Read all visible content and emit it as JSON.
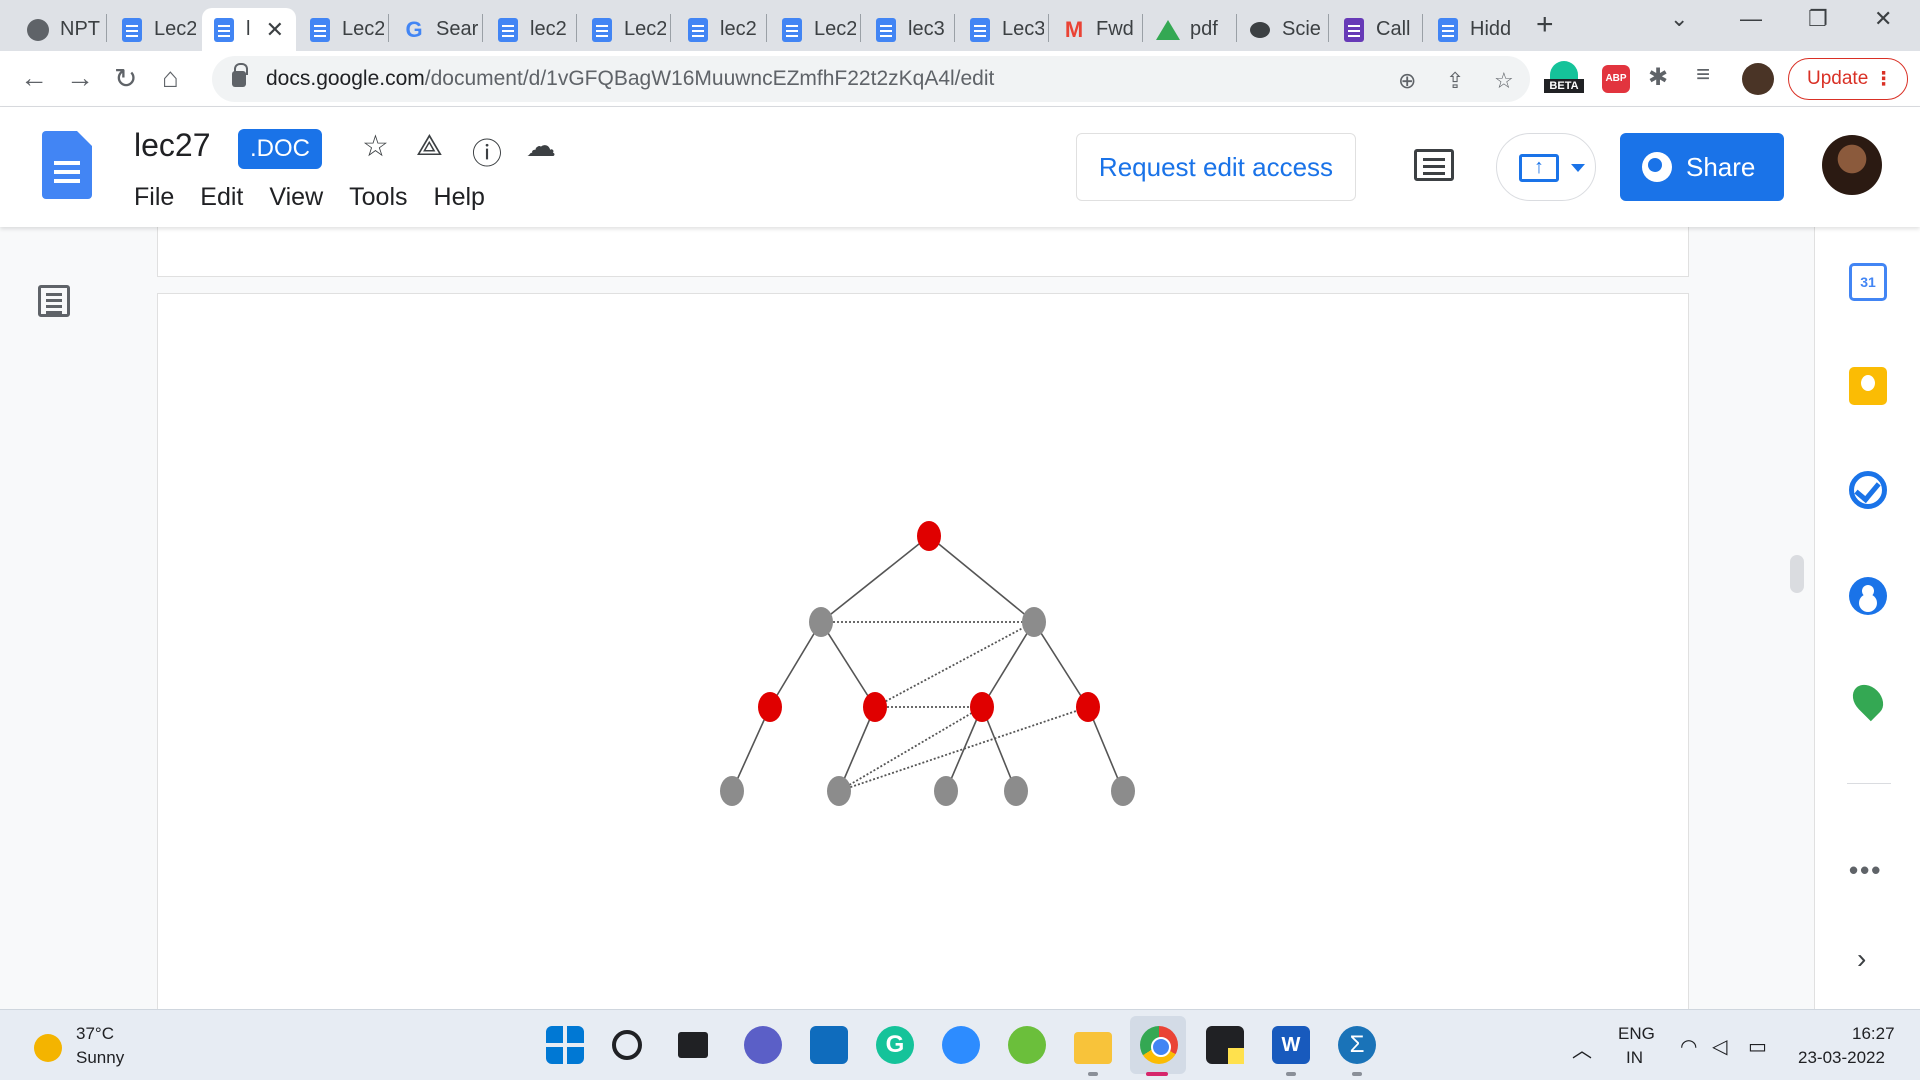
{
  "browser": {
    "tabs": [
      {
        "label": "NPT",
        "icon": "globe-icon"
      },
      {
        "label": "Lec2",
        "icon": "docs-icon"
      },
      {
        "label": "l",
        "icon": "docs-icon",
        "active": true
      },
      {
        "label": "Lec2",
        "icon": "docs-icon"
      },
      {
        "label": "Sear",
        "icon": "google-icon"
      },
      {
        "label": "lec2",
        "icon": "docs-icon"
      },
      {
        "label": "Lec2",
        "icon": "docs-icon"
      },
      {
        "label": "lec2",
        "icon": "docs-icon"
      },
      {
        "label": "Lec2",
        "icon": "docs-icon"
      },
      {
        "label": "lec3",
        "icon": "docs-icon"
      },
      {
        "label": "Lec3",
        "icon": "docs-icon"
      },
      {
        "label": "Fwd",
        "icon": "gmail-icon"
      },
      {
        "label": "pdf",
        "icon": "drive-icon"
      },
      {
        "label": "Scie",
        "icon": "chat-icon"
      },
      {
        "label": "Call",
        "icon": "forms-icon"
      },
      {
        "label": "Hidd",
        "icon": "docs-icon"
      }
    ],
    "new_tab_symbol": "+",
    "url_host": "docs.google.com",
    "url_path": "/document/d/1vGFQBagW16MuuwncEZmfhF22t2zKqA4l/edit",
    "beta_label": "BETA",
    "abp_label": "ABP",
    "update_label": "Update"
  },
  "docs": {
    "title": "lec27",
    "badge": ".DOC",
    "menu": [
      "File",
      "Edit",
      "View",
      "Tools",
      "Help"
    ],
    "request_edit_label": "Request edit access",
    "share_label": "Share"
  },
  "figure": {
    "colors": {
      "highlighted": "#e00000",
      "default": "#8c8c8c",
      "edge": "#555555"
    },
    "nodes": [
      {
        "id": "root",
        "level": 0,
        "color": "highlighted"
      },
      {
        "id": "a1",
        "level": 1,
        "color": "default"
      },
      {
        "id": "a2",
        "level": 1,
        "color": "default"
      },
      {
        "id": "b1",
        "level": 2,
        "color": "highlighted"
      },
      {
        "id": "b2",
        "level": 2,
        "color": "highlighted"
      },
      {
        "id": "b3",
        "level": 2,
        "color": "highlighted"
      },
      {
        "id": "b4",
        "level": 2,
        "color": "highlighted"
      },
      {
        "id": "c1",
        "level": 3,
        "color": "default"
      },
      {
        "id": "c2",
        "level": 3,
        "color": "default"
      },
      {
        "id": "c3",
        "level": 3,
        "color": "default"
      },
      {
        "id": "c4",
        "level": 3,
        "color": "default"
      },
      {
        "id": "c5",
        "level": 3,
        "color": "default"
      }
    ],
    "tree_edges": [
      [
        "root",
        "a1"
      ],
      [
        "root",
        "a2"
      ],
      [
        "a1",
        "b1"
      ],
      [
        "a1",
        "b2"
      ],
      [
        "a2",
        "b3"
      ],
      [
        "a2",
        "b4"
      ],
      [
        "b1",
        "c1"
      ],
      [
        "b2",
        "c2"
      ],
      [
        "b3",
        "c3"
      ],
      [
        "b3",
        "c4"
      ],
      [
        "b4",
        "c5"
      ]
    ],
    "dotted_edges": [
      [
        "a1",
        "a2"
      ],
      [
        "b2",
        "a2"
      ],
      [
        "b2",
        "b3"
      ],
      [
        "c2",
        "b3"
      ],
      [
        "c2",
        "b4"
      ]
    ]
  },
  "taskbar": {
    "weather_temp": "37°C",
    "weather_condition": "Sunny",
    "grammarly_letter": "G",
    "word_letter": "W",
    "sigma_symbol": "Σ",
    "lang_line1": "ENG",
    "lang_line2": "IN",
    "time": "16:27",
    "date": "23-03-2022"
  },
  "side_panel": {
    "calendar_day": "31"
  }
}
